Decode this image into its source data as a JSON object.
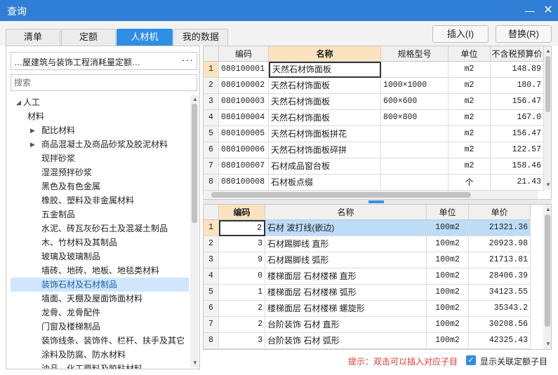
{
  "window": {
    "title": "查询",
    "minimize": "—",
    "close": "✕"
  },
  "tabs": [
    "清单",
    "定额",
    "人材机",
    "我的数据"
  ],
  "toolbar": {
    "insert": "插入(I)",
    "replace": "替换(R)"
  },
  "left": {
    "quota_library": "…屋建筑与装饰工程消耗量定额…",
    "more": "···",
    "search_placeholder": "搜索",
    "tree": [
      {
        "label": "人工"
      },
      {
        "label": "材料"
      },
      {
        "label": "配比材料"
      },
      {
        "label": "商品混凝土及商品砂浆及胶泥材料"
      },
      {
        "label": "现拌砂浆"
      },
      {
        "label": "湿混预拌砂浆"
      },
      {
        "label": "黑色及有色金属"
      },
      {
        "label": "橡胶、塑料及非金属材料"
      },
      {
        "label": "五金制品"
      },
      {
        "label": "水泥、砖瓦灰砂石土及混凝土制品"
      },
      {
        "label": "木、竹材料及其制品"
      },
      {
        "label": "玻璃及玻璃制品"
      },
      {
        "label": "墙砖、地砖、地板、地毯类材料"
      },
      {
        "label": "装饰石材及石材制品"
      },
      {
        "label": "墙面、天棚及屋面饰面材料"
      },
      {
        "label": "龙骨、龙骨配件"
      },
      {
        "label": "门窗及楼梯制品"
      },
      {
        "label": "装饰线条、装饰件、栏杆、扶手及其它"
      },
      {
        "label": "涂料及防腐、防水材料"
      },
      {
        "label": "油品、化工原料及胶粘材料"
      }
    ]
  },
  "top_table": {
    "headers": [
      "编码",
      "名称",
      "规格型号",
      "单位",
      "不含税预算价"
    ],
    "rows": [
      {
        "n": "1",
        "code": "080100001",
        "name": "天然石材饰面板",
        "spec": "",
        "unit": "m2",
        "price": "148.89"
      },
      {
        "n": "2",
        "code": "080100002",
        "name": "天然石材饰面板",
        "spec": "1000×1000",
        "unit": "m2",
        "price": "180.7"
      },
      {
        "n": "3",
        "code": "080100003",
        "name": "天然石材饰面板",
        "spec": "600×600",
        "unit": "m2",
        "price": "156.47"
      },
      {
        "n": "4",
        "code": "080100004",
        "name": "天然石材饰面板",
        "spec": "800×800",
        "unit": "m2",
        "price": "167.0"
      },
      {
        "n": "5",
        "code": "080100005",
        "name": "天然石材饰面板拼花",
        "spec": "",
        "unit": "m2",
        "price": "156.47"
      },
      {
        "n": "6",
        "code": "080100006",
        "name": "天然石材饰面板碎拼",
        "spec": "",
        "unit": "m2",
        "price": "122.57"
      },
      {
        "n": "7",
        "code": "080100007",
        "name": "石材成品窗台板",
        "spec": "",
        "unit": "m2",
        "price": "158.46"
      },
      {
        "n": "8",
        "code": "080100008",
        "name": "石材板点缀",
        "spec": "",
        "unit": "个",
        "price": "21.43"
      }
    ]
  },
  "bottom_table": {
    "headers": [
      "编码",
      "名称",
      "单位",
      "单价"
    ],
    "rows": [
      {
        "n": "1",
        "code": "2",
        "name": "石材 波打线(嵌边)",
        "unit": "100m2",
        "price": "21321.36"
      },
      {
        "n": "2",
        "code": "3",
        "name": "石材踢脚线 直形",
        "unit": "100m2",
        "price": "20923.98"
      },
      {
        "n": "3",
        "code": "9",
        "name": "石材踢脚线 弧形",
        "unit": "100m2",
        "price": "21713.81"
      },
      {
        "n": "4",
        "code": "0",
        "name": "楼梯面层 石材楼梯 直形",
        "unit": "100m2",
        "price": "28406.39"
      },
      {
        "n": "5",
        "code": "1",
        "name": "楼梯面层 石材楼梯 弧形",
        "unit": "100m2",
        "price": "34123.55"
      },
      {
        "n": "6",
        "code": "2",
        "name": "楼梯面层 石材楼梯 螺旋形",
        "unit": "100m2",
        "price": "35343.2"
      },
      {
        "n": "7",
        "code": "2",
        "name": "台阶装饰 石材 直形",
        "unit": "100m2",
        "price": "30208.56"
      },
      {
        "n": "8",
        "code": "3",
        "name": "台阶装饰 石材 弧形",
        "unit": "100m2",
        "price": "42325.43"
      }
    ]
  },
  "footer": {
    "hint": "提示：双击可以插入对应子目",
    "checkbox_label": "显示关联定额子目",
    "checkbox_mark": "✓"
  }
}
